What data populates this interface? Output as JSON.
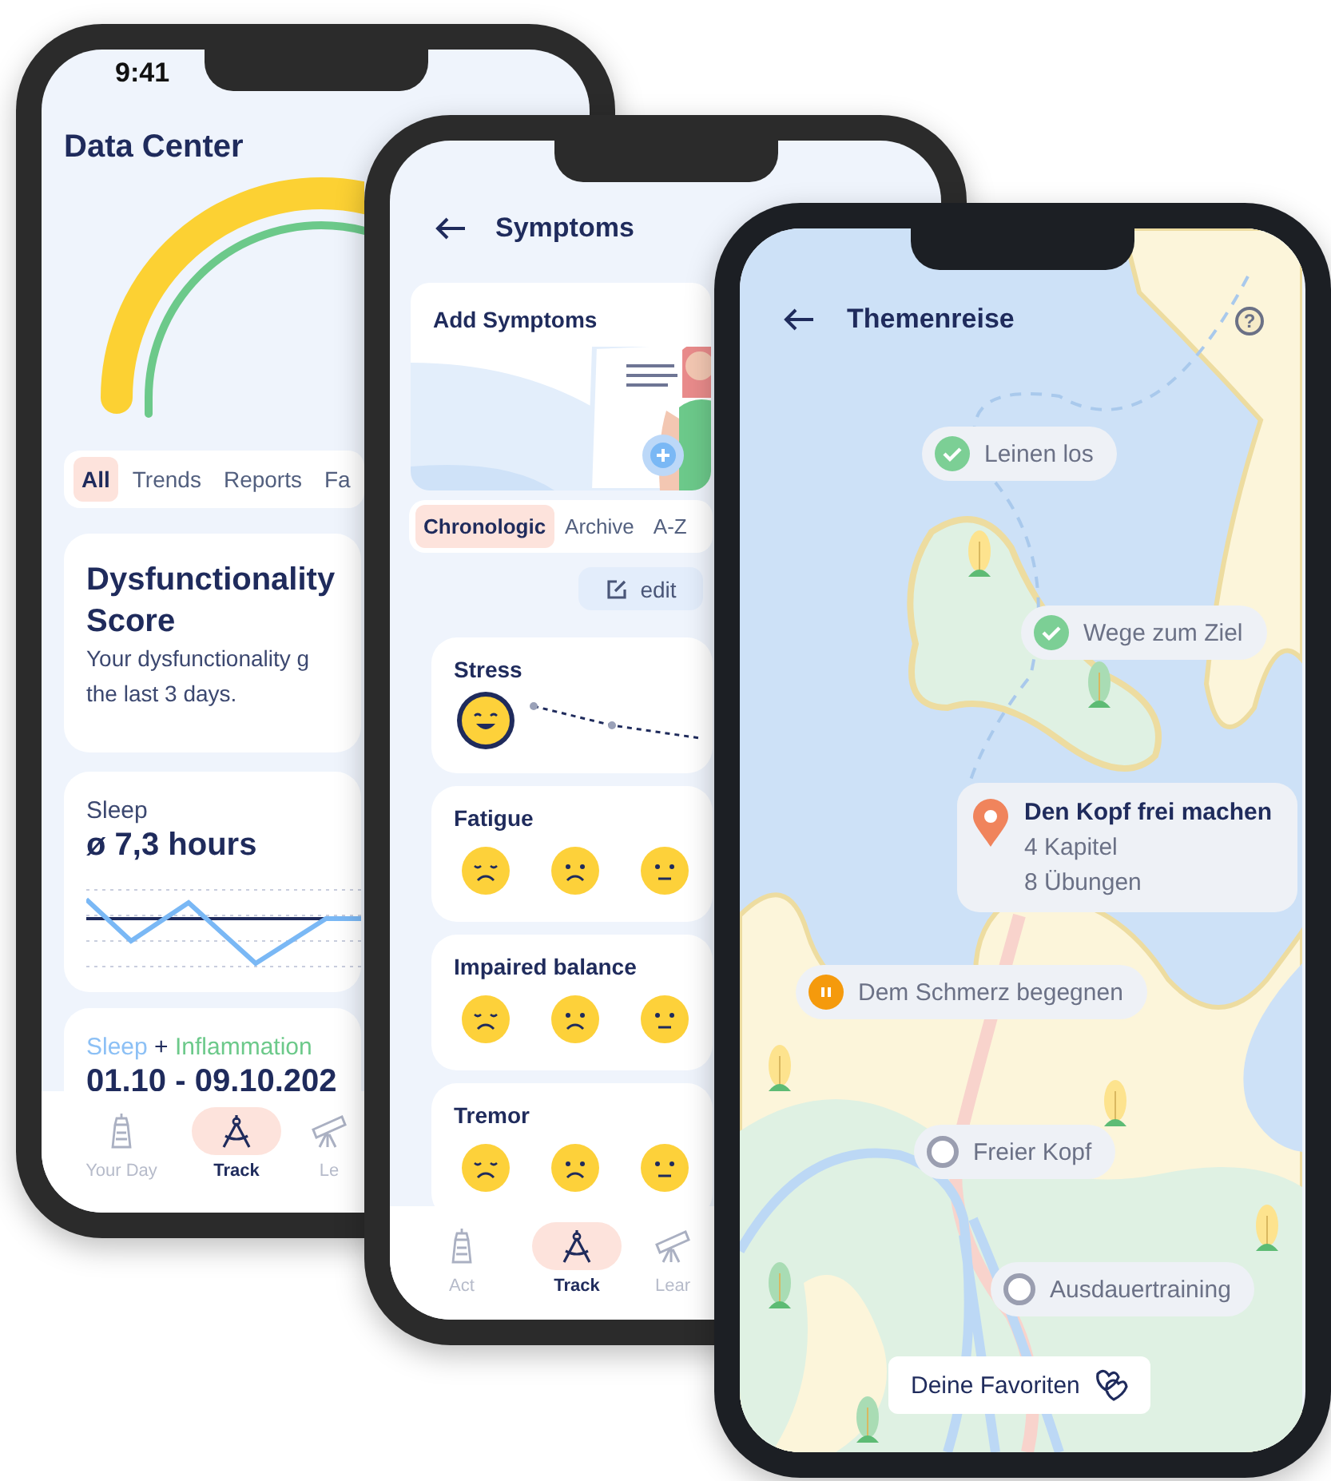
{
  "data_center": {
    "time": "9:41",
    "title": "Data Center",
    "tabs": [
      {
        "label": "All",
        "selected": true
      },
      {
        "label": "Trends",
        "selected": false
      },
      {
        "label": "Reports",
        "selected": false
      },
      {
        "label": "Fa",
        "selected": false
      }
    ],
    "score_card": {
      "title": "Dysfunctionality Score",
      "text_lines": [
        "Your dysfunctionality g",
        "the last 3 days."
      ]
    },
    "sleep_card": {
      "label": "Sleep",
      "value": "ø 7,3 hours"
    },
    "combo_card": {
      "series": [
        {
          "label": "Sleep",
          "color": "#8cc0f5"
        },
        {
          "label": "Inflammation",
          "color": "#6cc98a"
        }
      ],
      "joiner": "+",
      "range": "01.10 - 09.10.202"
    },
    "nav": [
      {
        "label": "Your Day",
        "selected": false
      },
      {
        "label": "Track",
        "selected": true
      },
      {
        "label": "Le",
        "selected": false
      }
    ]
  },
  "symptoms": {
    "title": "Symptoms",
    "banner": "Add Symptoms",
    "tabs": [
      {
        "label": "Chronologic",
        "selected": true
      },
      {
        "label": "Archive",
        "selected": false
      },
      {
        "label": "A-Z",
        "selected": false
      }
    ],
    "edit": "edit",
    "cards": [
      {
        "name": "Stress",
        "kind": "trend"
      },
      {
        "name": "Fatigue",
        "kind": "scale"
      },
      {
        "name": "Impaired balance",
        "kind": "scale"
      },
      {
        "name": "Tremor",
        "kind": "scale"
      }
    ],
    "nav": [
      {
        "label": "Act",
        "selected": false
      },
      {
        "label": "Track",
        "selected": true
      },
      {
        "label": "Lear",
        "selected": false
      }
    ]
  },
  "themenreise": {
    "title": "Themenreise",
    "help": "?",
    "stops": [
      {
        "name": "Leinen los",
        "kind": "done"
      },
      {
        "name": "Wege zum Ziel",
        "kind": "done"
      },
      {
        "name": "Den Kopf frei machen",
        "kind": "current",
        "details": [
          "4 Kapitel",
          "8 Übungen"
        ]
      },
      {
        "name": "Dem Schmerz begegnen",
        "kind": "paused"
      },
      {
        "name": "Freier Kopf",
        "kind": "open"
      },
      {
        "name": "Ausdauertraining",
        "kind": "open"
      }
    ],
    "favorites": "Deine Favoriten"
  }
}
